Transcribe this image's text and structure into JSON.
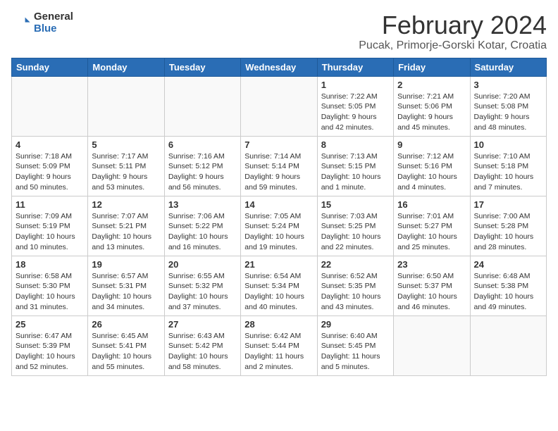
{
  "logo": {
    "general": "General",
    "blue": "Blue"
  },
  "header": {
    "title": "February 2024",
    "subtitle": "Pucak, Primorje-Gorski Kotar, Croatia"
  },
  "weekdays": [
    "Sunday",
    "Monday",
    "Tuesday",
    "Wednesday",
    "Thursday",
    "Friday",
    "Saturday"
  ],
  "weeks": [
    [
      {
        "day": "",
        "info": ""
      },
      {
        "day": "",
        "info": ""
      },
      {
        "day": "",
        "info": ""
      },
      {
        "day": "",
        "info": ""
      },
      {
        "day": "1",
        "info": "Sunrise: 7:22 AM\nSunset: 5:05 PM\nDaylight: 9 hours\nand 42 minutes."
      },
      {
        "day": "2",
        "info": "Sunrise: 7:21 AM\nSunset: 5:06 PM\nDaylight: 9 hours\nand 45 minutes."
      },
      {
        "day": "3",
        "info": "Sunrise: 7:20 AM\nSunset: 5:08 PM\nDaylight: 9 hours\nand 48 minutes."
      }
    ],
    [
      {
        "day": "4",
        "info": "Sunrise: 7:18 AM\nSunset: 5:09 PM\nDaylight: 9 hours\nand 50 minutes."
      },
      {
        "day": "5",
        "info": "Sunrise: 7:17 AM\nSunset: 5:11 PM\nDaylight: 9 hours\nand 53 minutes."
      },
      {
        "day": "6",
        "info": "Sunrise: 7:16 AM\nSunset: 5:12 PM\nDaylight: 9 hours\nand 56 minutes."
      },
      {
        "day": "7",
        "info": "Sunrise: 7:14 AM\nSunset: 5:14 PM\nDaylight: 9 hours\nand 59 minutes."
      },
      {
        "day": "8",
        "info": "Sunrise: 7:13 AM\nSunset: 5:15 PM\nDaylight: 10 hours\nand 1 minute."
      },
      {
        "day": "9",
        "info": "Sunrise: 7:12 AM\nSunset: 5:16 PM\nDaylight: 10 hours\nand 4 minutes."
      },
      {
        "day": "10",
        "info": "Sunrise: 7:10 AM\nSunset: 5:18 PM\nDaylight: 10 hours\nand 7 minutes."
      }
    ],
    [
      {
        "day": "11",
        "info": "Sunrise: 7:09 AM\nSunset: 5:19 PM\nDaylight: 10 hours\nand 10 minutes."
      },
      {
        "day": "12",
        "info": "Sunrise: 7:07 AM\nSunset: 5:21 PM\nDaylight: 10 hours\nand 13 minutes."
      },
      {
        "day": "13",
        "info": "Sunrise: 7:06 AM\nSunset: 5:22 PM\nDaylight: 10 hours\nand 16 minutes."
      },
      {
        "day": "14",
        "info": "Sunrise: 7:05 AM\nSunset: 5:24 PM\nDaylight: 10 hours\nand 19 minutes."
      },
      {
        "day": "15",
        "info": "Sunrise: 7:03 AM\nSunset: 5:25 PM\nDaylight: 10 hours\nand 22 minutes."
      },
      {
        "day": "16",
        "info": "Sunrise: 7:01 AM\nSunset: 5:27 PM\nDaylight: 10 hours\nand 25 minutes."
      },
      {
        "day": "17",
        "info": "Sunrise: 7:00 AM\nSunset: 5:28 PM\nDaylight: 10 hours\nand 28 minutes."
      }
    ],
    [
      {
        "day": "18",
        "info": "Sunrise: 6:58 AM\nSunset: 5:30 PM\nDaylight: 10 hours\nand 31 minutes."
      },
      {
        "day": "19",
        "info": "Sunrise: 6:57 AM\nSunset: 5:31 PM\nDaylight: 10 hours\nand 34 minutes."
      },
      {
        "day": "20",
        "info": "Sunrise: 6:55 AM\nSunset: 5:32 PM\nDaylight: 10 hours\nand 37 minutes."
      },
      {
        "day": "21",
        "info": "Sunrise: 6:54 AM\nSunset: 5:34 PM\nDaylight: 10 hours\nand 40 minutes."
      },
      {
        "day": "22",
        "info": "Sunrise: 6:52 AM\nSunset: 5:35 PM\nDaylight: 10 hours\nand 43 minutes."
      },
      {
        "day": "23",
        "info": "Sunrise: 6:50 AM\nSunset: 5:37 PM\nDaylight: 10 hours\nand 46 minutes."
      },
      {
        "day": "24",
        "info": "Sunrise: 6:48 AM\nSunset: 5:38 PM\nDaylight: 10 hours\nand 49 minutes."
      }
    ],
    [
      {
        "day": "25",
        "info": "Sunrise: 6:47 AM\nSunset: 5:39 PM\nDaylight: 10 hours\nand 52 minutes."
      },
      {
        "day": "26",
        "info": "Sunrise: 6:45 AM\nSunset: 5:41 PM\nDaylight: 10 hours\nand 55 minutes."
      },
      {
        "day": "27",
        "info": "Sunrise: 6:43 AM\nSunset: 5:42 PM\nDaylight: 10 hours\nand 58 minutes."
      },
      {
        "day": "28",
        "info": "Sunrise: 6:42 AM\nSunset: 5:44 PM\nDaylight: 11 hours\nand 2 minutes."
      },
      {
        "day": "29",
        "info": "Sunrise: 6:40 AM\nSunset: 5:45 PM\nDaylight: 11 hours\nand 5 minutes."
      },
      {
        "day": "",
        "info": ""
      },
      {
        "day": "",
        "info": ""
      }
    ]
  ]
}
